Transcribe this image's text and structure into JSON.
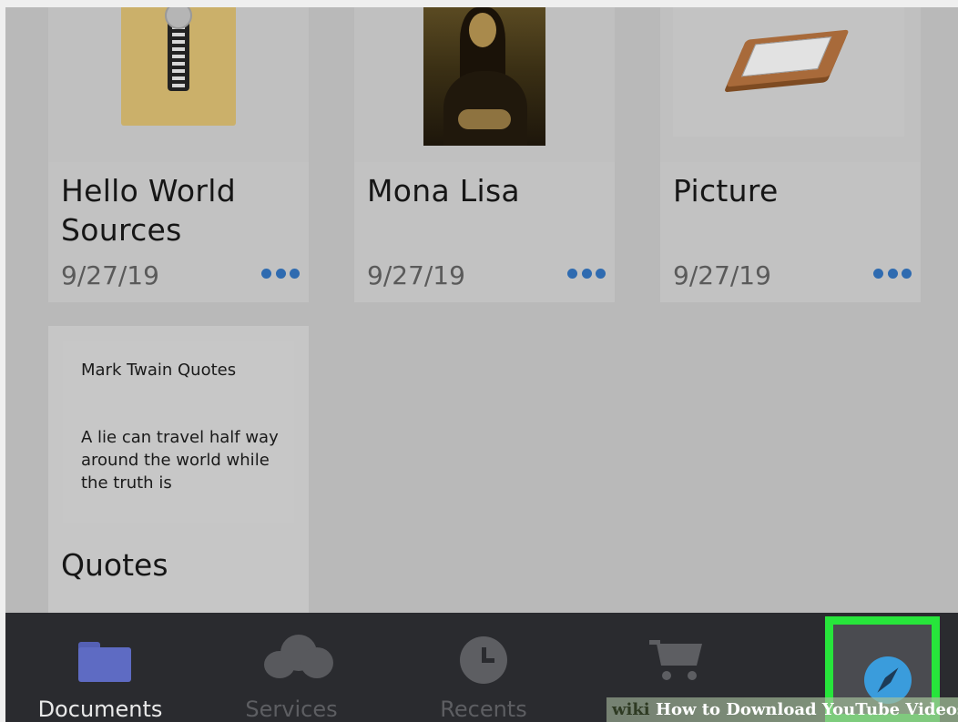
{
  "documents": [
    {
      "title": "Hello World Sources",
      "date": "9/27/19",
      "thumbnail": "zip-archive-icon"
    },
    {
      "title": "Mona Lisa",
      "date": "9/27/19",
      "thumbnail": "mona-lisa-image"
    },
    {
      "title": "Picture",
      "date": "9/27/19",
      "thumbnail": "document-tray-icon"
    },
    {
      "title": "Quotes",
      "thumbnail": "text-note",
      "note_title": "Mark Twain Quotes",
      "note_body": "A lie can travel half way around the world while the truth is"
    }
  ],
  "tabbar": {
    "tabs": [
      {
        "label": "Documents",
        "icon": "folder-icon",
        "active": true
      },
      {
        "label": "Services",
        "icon": "cloud-icon",
        "active": false
      },
      {
        "label": "Recents",
        "icon": "clock-icon",
        "active": false
      },
      {
        "label": "",
        "icon": "cart-icon",
        "active": false
      },
      {
        "label": "",
        "icon": "compass-icon",
        "active": false,
        "highlighted": true
      }
    ]
  },
  "colors": {
    "accent_dots": "#2f6bb0",
    "highlight": "#27e53b",
    "compass": "#3a9cdc",
    "folder": "#5e6bc3"
  },
  "watermark": {
    "brand": "wiki",
    "text": "How to Download YouTube Videos"
  }
}
